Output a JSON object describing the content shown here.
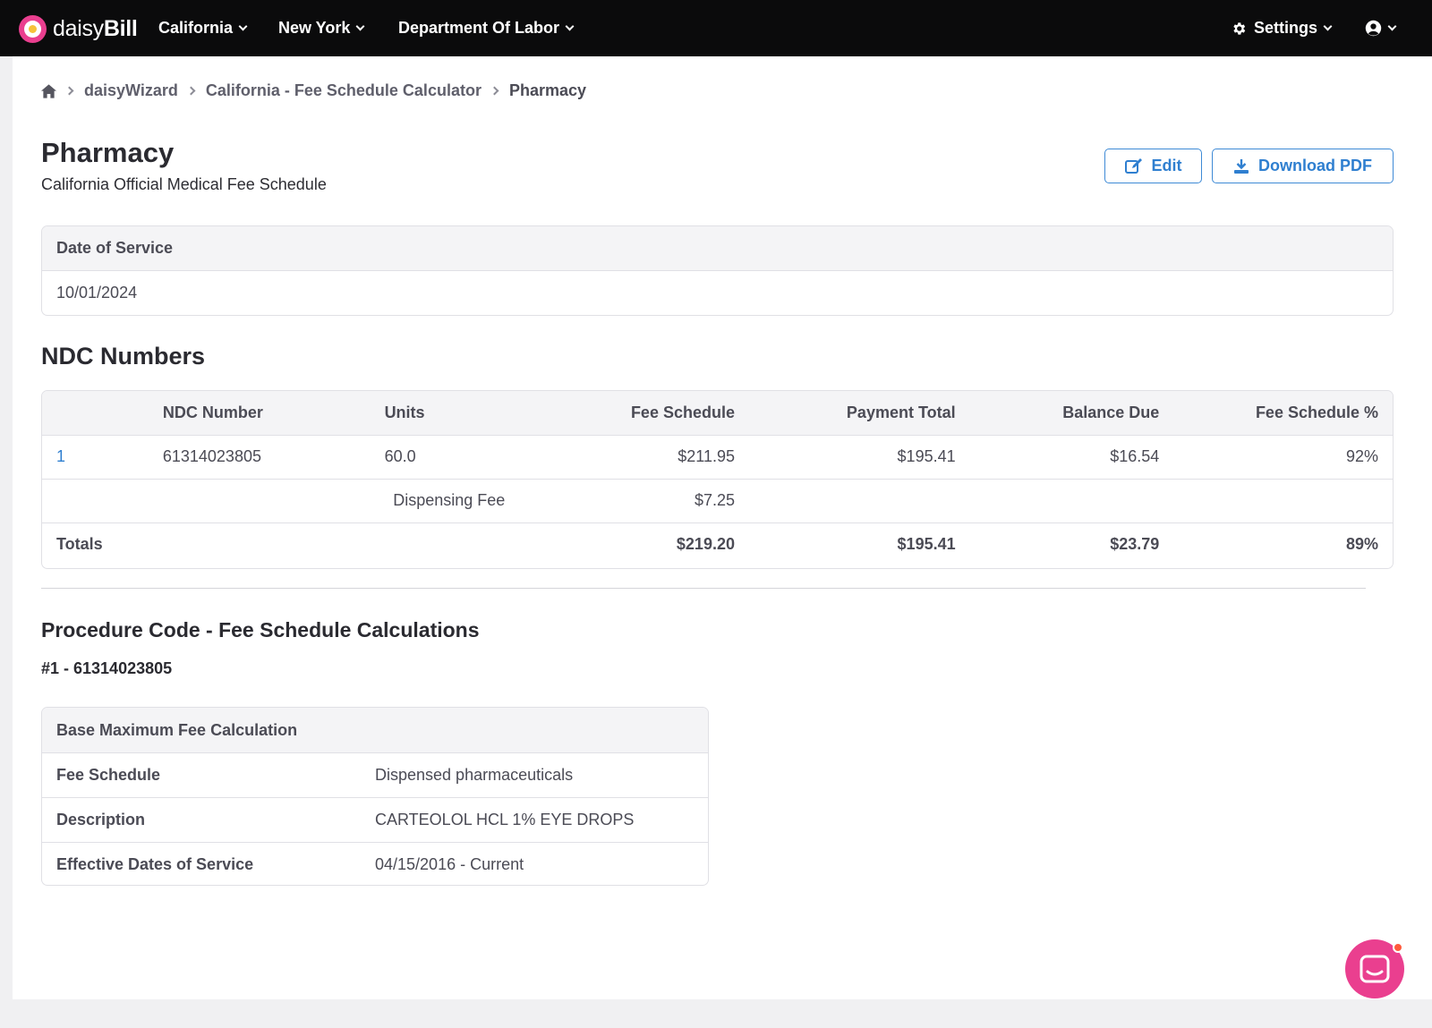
{
  "brand": {
    "name_light": "daisy",
    "name_bold": "Bill"
  },
  "nav": {
    "items": [
      {
        "label": "California"
      },
      {
        "label": "New York"
      },
      {
        "label": "Department Of Labor"
      }
    ],
    "settings_label": "Settings"
  },
  "breadcrumb": [
    "daisyWizard",
    "California - Fee Schedule Calculator",
    "Pharmacy"
  ],
  "page": {
    "title": "Pharmacy",
    "subtitle": "California Official Medical Fee Schedule",
    "edit_label": "Edit",
    "download_label": "Download PDF"
  },
  "date_of_service": {
    "label": "Date of Service",
    "value": "10/01/2024"
  },
  "ndc": {
    "heading": "NDC Numbers",
    "columns": [
      "",
      "NDC Number",
      "Units",
      "Fee Schedule",
      "Payment Total",
      "Balance Due",
      "Fee Schedule %"
    ],
    "row": {
      "index": "1",
      "ndc": "61314023805",
      "units": "60.0",
      "fee": "$211.95",
      "payment": "$195.41",
      "balance": "$16.54",
      "pct": "92%"
    },
    "dispensing": {
      "label": "Dispensing Fee",
      "fee": "$7.25"
    },
    "totals": {
      "label": "Totals",
      "fee": "$219.20",
      "payment": "$195.41",
      "balance": "$23.79",
      "pct": "89%"
    }
  },
  "procedure": {
    "heading": "Procedure Code - Fee Schedule Calculations",
    "item_id": "#1 - 61314023805",
    "box_title": "Base Maximum Fee Calculation",
    "rows": [
      {
        "label": "Fee Schedule",
        "value": "Dispensed pharmaceuticals"
      },
      {
        "label": "Description",
        "value": "CARTEOLOL HCL 1% EYE DROPS"
      },
      {
        "label": "Effective Dates of Service",
        "value": "04/15/2016 - Current"
      }
    ]
  },
  "colors": {
    "brand": "#ea3f8f",
    "link": "#2f7fd0",
    "topbar": "#0b0b0c"
  },
  "icons": [
    "daisy-logo-icon",
    "chevron-down-icon",
    "gear-icon",
    "user-circle-icon",
    "home-icon",
    "chevron-right-icon",
    "edit-icon",
    "download-icon",
    "chat-icon"
  ]
}
